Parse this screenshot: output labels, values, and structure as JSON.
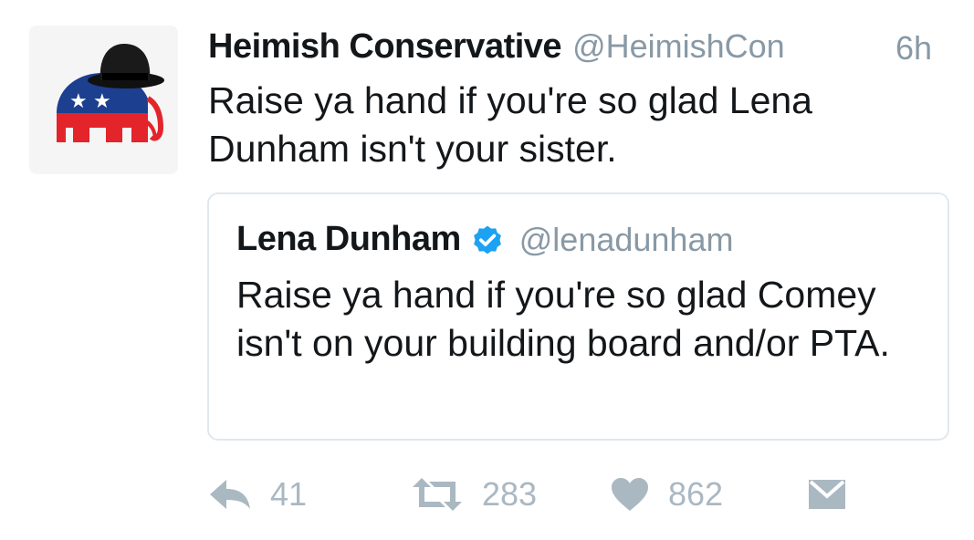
{
  "tweet": {
    "author": {
      "display_name": "Heimish Conservative",
      "handle": "@HeimishCon",
      "avatar_icon": "republican-elephant-with-fedora"
    },
    "timestamp": "6h",
    "text": "Raise ya hand if you're so glad Lena Dunham isn't your sister.",
    "quoted": {
      "display_name": "Lena Dunham",
      "verified": true,
      "handle": "@lenadunham",
      "text": "Raise ya hand if you're so glad Comey isn't on your building board and/or PTA."
    },
    "actions": {
      "reply": {
        "icon": "reply-icon",
        "count": "41"
      },
      "retweet": {
        "icon": "retweet-icon",
        "count": "283"
      },
      "like": {
        "icon": "heart-icon",
        "count": "862"
      },
      "message": {
        "icon": "envelope-icon"
      }
    }
  },
  "colors": {
    "text_primary": "#14171a",
    "text_secondary": "#8899a6",
    "action_gray": "#aab8c2",
    "verified_blue": "#1da1f2",
    "border": "#e1e8ed",
    "gop_blue": "#1c3f8f",
    "gop_red": "#e3242b"
  }
}
